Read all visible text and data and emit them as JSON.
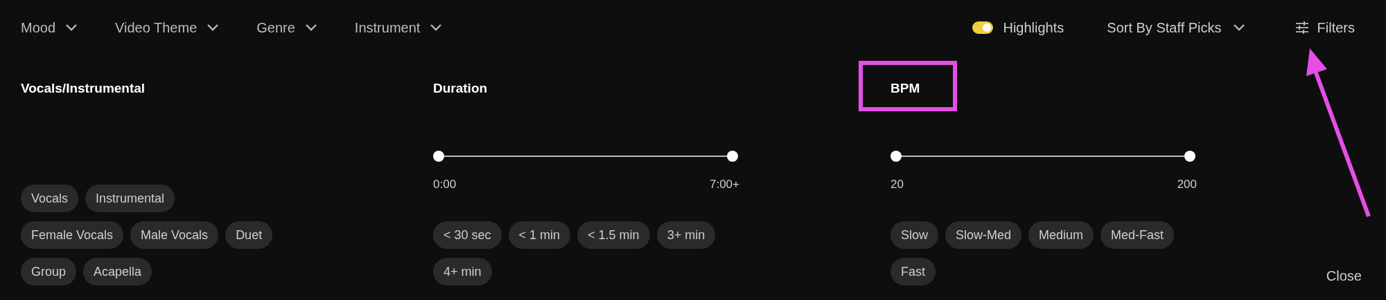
{
  "nav": {
    "dropdowns": [
      {
        "label": "Mood"
      },
      {
        "label": "Video Theme"
      },
      {
        "label": "Genre"
      },
      {
        "label": "Instrument"
      }
    ],
    "highlights": {
      "label": "Highlights",
      "on": true
    },
    "sort": {
      "label": "Sort By Staff Picks"
    },
    "filters": {
      "label": "Filters"
    }
  },
  "sections": [
    {
      "kind": "chips",
      "title": "Vocals/Instrumental",
      "chip_rows": [
        [
          "Vocals",
          "Instrumental"
        ],
        [
          "Female Vocals",
          "Male Vocals",
          "Duet"
        ],
        [
          "Group",
          "Acapella"
        ]
      ]
    },
    {
      "kind": "range",
      "title": "Duration",
      "thumbs": [
        {
          "level": 0
        },
        {
          "level": 1
        }
      ],
      "min_label": "0:00",
      "max_label": "7:00+",
      "chip_rows": [
        [
          "< 30 sec",
          "< 1 min",
          "< 1.5 min",
          "3+ min"
        ],
        [
          "4+ min"
        ]
      ]
    },
    {
      "kind": "range",
      "title": "BPM",
      "thumbs": [
        {
          "level": 0
        },
        {
          "level": 1
        }
      ],
      "min_label": "20",
      "max_label": "200",
      "chip_rows": [
        [
          "Slow",
          "Slow-Med",
          "Medium",
          "Med-Fast"
        ],
        [
          "Fast"
        ]
      ]
    }
  ],
  "close": {
    "label": "Close"
  }
}
